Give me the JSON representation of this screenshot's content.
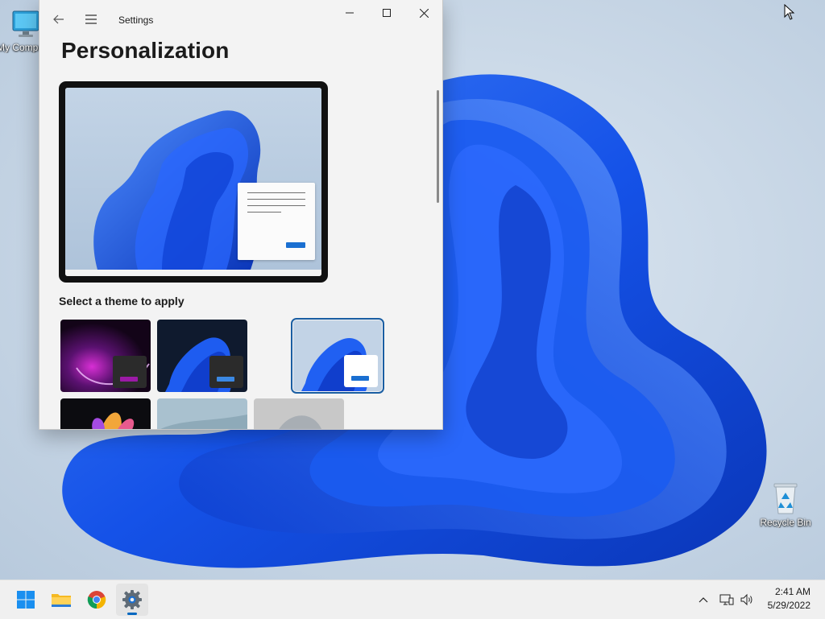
{
  "desktop": {
    "icons": [
      {
        "label": "My Computer",
        "icon": "computer-icon"
      },
      {
        "label": "Recycle Bin",
        "icon": "recycle-bin-icon"
      }
    ]
  },
  "settings": {
    "window_title": "Settings",
    "page_title": "Personalization",
    "theme_section_label": "Select a theme to apply",
    "themes": [
      {
        "name": "glow-dark",
        "mode": "dark"
      },
      {
        "name": "windows-dark",
        "mode": "dark"
      },
      {
        "name": "windows-light",
        "mode": "light",
        "selected": true
      },
      {
        "name": "captured-motion",
        "mode": "dark"
      },
      {
        "name": "flow",
        "mode": "light"
      },
      {
        "name": "sunrise",
        "mode": "light"
      }
    ],
    "accent_color": "#1a6fd1"
  },
  "taskbar": {
    "apps": [
      {
        "name": "start",
        "icon": "windows-logo-icon"
      },
      {
        "name": "file-explorer",
        "icon": "folder-icon"
      },
      {
        "name": "chrome",
        "icon": "chrome-icon"
      },
      {
        "name": "settings",
        "icon": "gear-icon",
        "active": true
      }
    ],
    "time": "2:41 AM",
    "date": "5/29/2022"
  }
}
